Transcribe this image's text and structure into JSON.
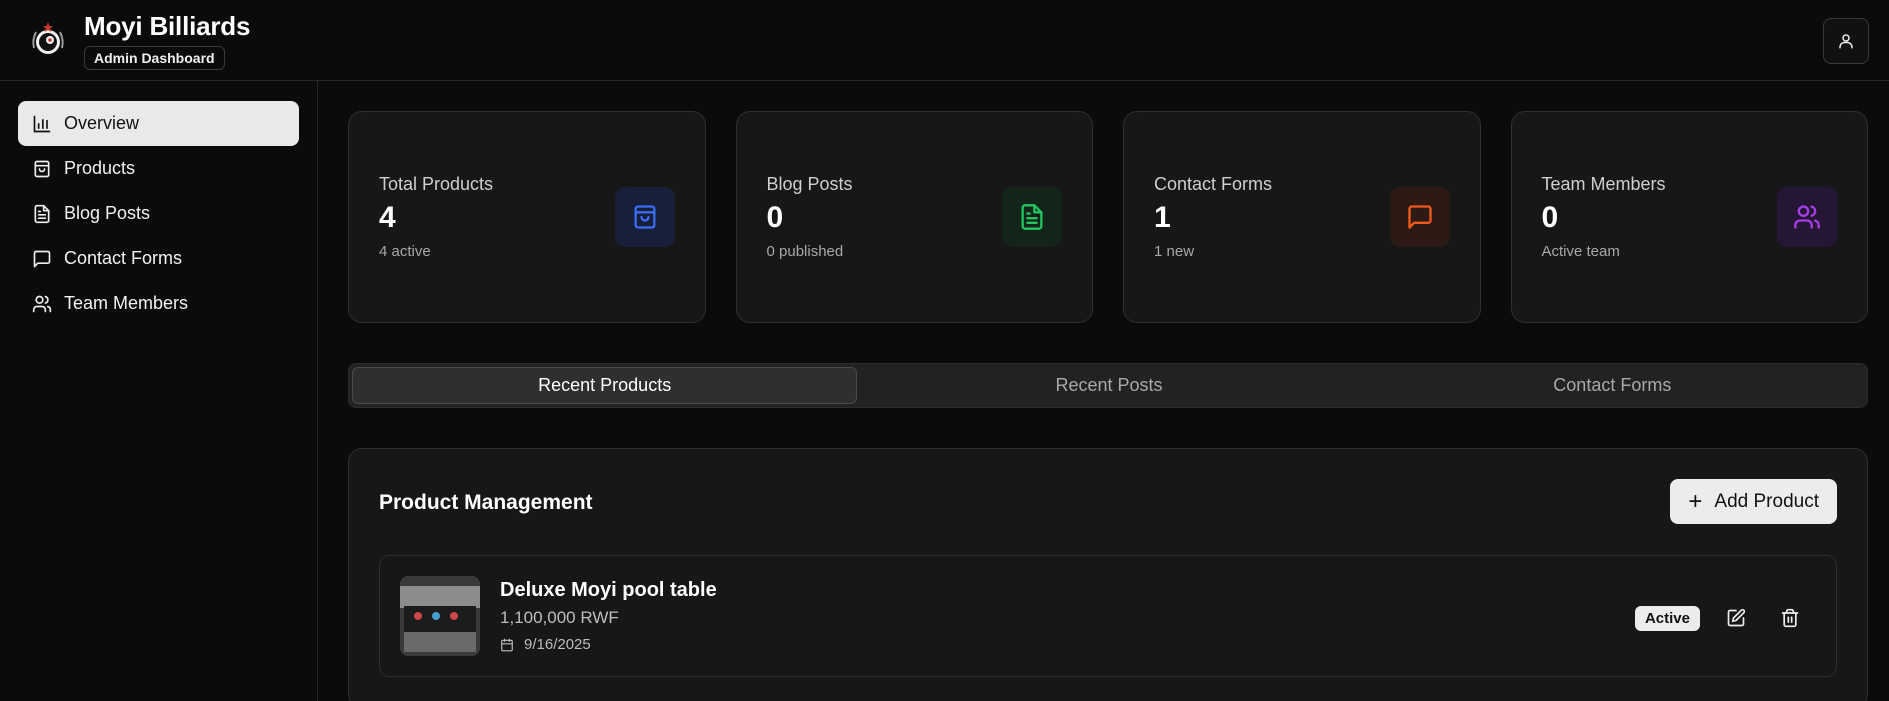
{
  "header": {
    "brand_name": "Moyi Billiards",
    "badge": "Admin Dashboard",
    "logo_icon": "billiard-ball-logo",
    "user_icon": "user-icon"
  },
  "sidebar": {
    "items": [
      {
        "label": "Overview",
        "icon": "bar-chart-icon",
        "active": true
      },
      {
        "label": "Products",
        "icon": "shopping-bag-icon",
        "active": false
      },
      {
        "label": "Blog Posts",
        "icon": "file-text-icon",
        "active": false
      },
      {
        "label": "Contact Forms",
        "icon": "message-square-icon",
        "active": false
      },
      {
        "label": "Team Members",
        "icon": "users-icon",
        "active": false
      }
    ]
  },
  "stats": [
    {
      "label": "Total Products",
      "value": "4",
      "sub": "4 active",
      "icon": "shopping-bag-icon",
      "color": "#3b6cf5"
    },
    {
      "label": "Blog Posts",
      "value": "0",
      "sub": "0 published",
      "icon": "file-text-icon",
      "color": "#22c55e"
    },
    {
      "label": "Contact Forms",
      "value": "1",
      "sub": "1 new",
      "icon": "message-square-icon",
      "color": "#f0591c"
    },
    {
      "label": "Team Members",
      "value": "0",
      "sub": "Active team",
      "icon": "users-icon",
      "color": "#a73ee8"
    }
  ],
  "tabs": [
    {
      "label": "Recent Products",
      "active": true
    },
    {
      "label": "Recent Posts",
      "active": false
    },
    {
      "label": "Contact Forms",
      "active": false
    }
  ],
  "panel": {
    "title": "Product Management",
    "add_button": "Add Product"
  },
  "products": [
    {
      "name": "Deluxe Moyi pool table",
      "price": "1,100,000 RWF",
      "date": "9/16/2025",
      "status": "Active"
    }
  ]
}
